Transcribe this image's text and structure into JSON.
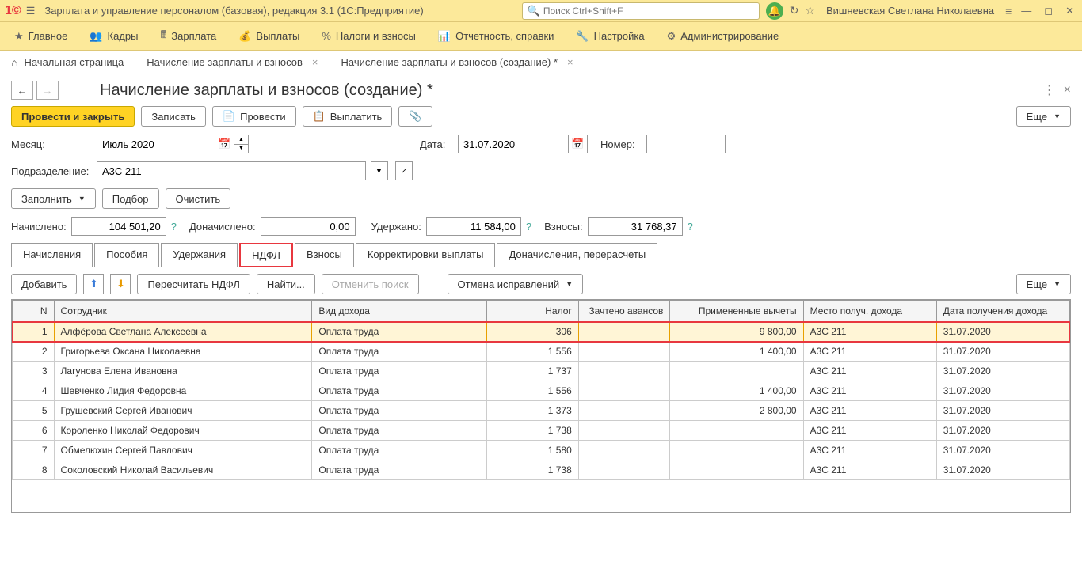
{
  "title": "Зарплата и управление персоналом (базовая), редакция 3.1  (1С:Предприятие)",
  "search_placeholder": "Поиск Ctrl+Shift+F",
  "user": "Вишневская Светлана Николаевна",
  "main_menu": [
    {
      "label": "Главное"
    },
    {
      "label": "Кадры"
    },
    {
      "label": "Зарплата"
    },
    {
      "label": "Выплаты"
    },
    {
      "label": "Налоги и взносы"
    },
    {
      "label": "Отчетность, справки"
    },
    {
      "label": "Настройка"
    },
    {
      "label": "Администрирование"
    }
  ],
  "tabs": [
    {
      "label": "Начальная страница",
      "home": true
    },
    {
      "label": "Начисление зарплаты и взносов",
      "closable": true
    },
    {
      "label": "Начисление зарплаты и взносов (создание) *",
      "closable": true,
      "active": true
    }
  ],
  "page_title": "Начисление зарплаты и взносов (создание) *",
  "toolbar": {
    "commit": "Провести и закрыть",
    "write": "Записать",
    "post": "Провести",
    "pay": "Выплатить",
    "more": "Еще"
  },
  "fields": {
    "month_label": "Месяц:",
    "month_value": "Июль 2020",
    "date_label": "Дата:",
    "date_value": "31.07.2020",
    "number_label": "Номер:",
    "number_value": "",
    "dept_label": "Подразделение:",
    "dept_value": "А3С 211",
    "fill": "Заполнить",
    "pick": "Подбор",
    "clear": "Очистить"
  },
  "totals": {
    "accrued_label": "Начислено:",
    "accrued": "104 501,20",
    "extra_label": "Доначислено:",
    "extra": "0,00",
    "withheld_label": "Удержано:",
    "withheld": "11 584,00",
    "contrib_label": "Взносы:",
    "contrib": "31 768,37"
  },
  "inner_tabs": [
    "Начисления",
    "Пособия",
    "Удержания",
    "НДФЛ",
    "Взносы",
    "Корректировки выплаты",
    "Доначисления, перерасчеты"
  ],
  "table_toolbar": {
    "add": "Добавить",
    "recalc": "Пересчитать НДФЛ",
    "find": "Найти...",
    "cancel_find": "Отменить поиск",
    "cancel_fix": "Отмена исправлений",
    "more": "Еще"
  },
  "columns": [
    "N",
    "Сотрудник",
    "Вид дохода",
    "Налог",
    "Зачтено авансов",
    "Примененные вычеты",
    "Место получ. дохода",
    "Дата получения дохода"
  ],
  "rows": [
    {
      "n": "1",
      "emp": "Алфёрова Светлана Алексеевна",
      "type": "Оплата труда",
      "tax": "306",
      "advance": "",
      "deduct": "9 800,00",
      "place": "А3С 211",
      "date": "31.07.2020",
      "hl": true
    },
    {
      "n": "2",
      "emp": "Григорьева Оксана Николаевна",
      "type": "Оплата труда",
      "tax": "1 556",
      "advance": "",
      "deduct": "1 400,00",
      "place": "А3С 211",
      "date": "31.07.2020"
    },
    {
      "n": "3",
      "emp": "Лагунова Елена Ивановна",
      "type": "Оплата труда",
      "tax": "1 737",
      "advance": "",
      "deduct": "",
      "place": "А3С 211",
      "date": "31.07.2020"
    },
    {
      "n": "4",
      "emp": "Шевченко Лидия Федоровна",
      "type": "Оплата труда",
      "tax": "1 556",
      "advance": "",
      "deduct": "1 400,00",
      "place": "А3С 211",
      "date": "31.07.2020"
    },
    {
      "n": "5",
      "emp": "Грушевский Сергей Иванович",
      "type": "Оплата труда",
      "tax": "1 373",
      "advance": "",
      "deduct": "2 800,00",
      "place": "А3С 211",
      "date": "31.07.2020"
    },
    {
      "n": "6",
      "emp": "Короленко Николай Федорович",
      "type": "Оплата труда",
      "tax": "1 738",
      "advance": "",
      "deduct": "",
      "place": "А3С 211",
      "date": "31.07.2020"
    },
    {
      "n": "7",
      "emp": "Обмелюхин Сергей Павлович",
      "type": "Оплата труда",
      "tax": "1 580",
      "advance": "",
      "deduct": "",
      "place": "А3С 211",
      "date": "31.07.2020"
    },
    {
      "n": "8",
      "emp": "Соколовский Николай Васильевич",
      "type": "Оплата труда",
      "tax": "1 738",
      "advance": "",
      "deduct": "",
      "place": "А3С 211",
      "date": "31.07.2020"
    }
  ]
}
